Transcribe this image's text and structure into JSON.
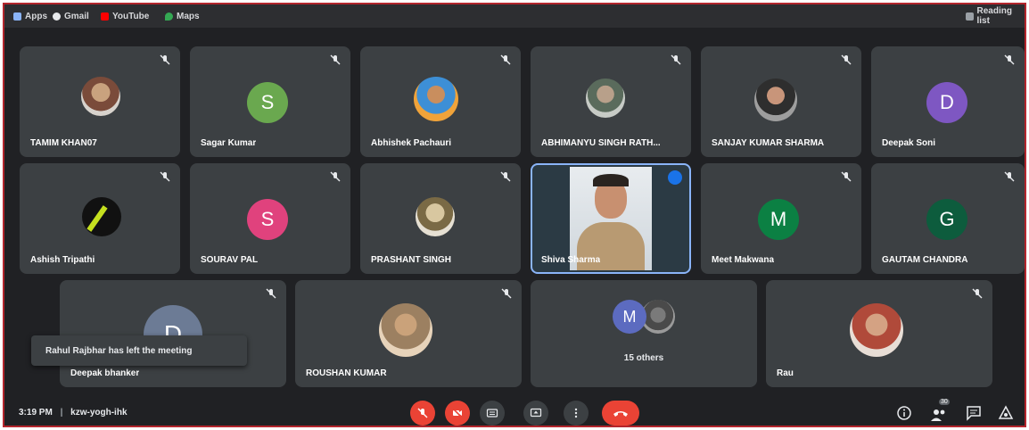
{
  "bookmarks": [
    {
      "label": "Apps",
      "icon": "apps-grid-icon",
      "color": "#8ab4f8"
    },
    {
      "label": "Gmail",
      "icon": "gmail-icon",
      "color": "#ea4335"
    },
    {
      "label": "YouTube",
      "icon": "youtube-icon",
      "color": "#ff0000"
    },
    {
      "label": "Maps",
      "icon": "maps-pin-icon",
      "color": "#34a853"
    }
  ],
  "reading_list": "Reading list",
  "participants": [
    {
      "name": "TAMIM KHAN07"
    },
    {
      "name": "Sagar Kumar",
      "initial": "S",
      "color": "#6aa84f"
    },
    {
      "name": "Abhishek Pachauri"
    },
    {
      "name": "ABHIMANYU SINGH RATH..."
    },
    {
      "name": "SANJAY KUMAR SHARMA"
    },
    {
      "name": "Deepak Soni",
      "initial": "D",
      "color": "#7e57c2"
    },
    {
      "name": "Ashish Tripathi"
    },
    {
      "name": "SOURAV PAL",
      "initial": "S",
      "color": "#e0427d"
    },
    {
      "name": "PRASHANT SINGH"
    },
    {
      "name": "Shiva Sharma"
    },
    {
      "name": "Meet Makwana",
      "initial": "M",
      "color": "#0b8043"
    },
    {
      "name": "GAUTAM CHANDRA",
      "initial": "G",
      "color": "#0d5c3d"
    },
    {
      "name": "Deepak bhanker",
      "initial": "D",
      "color": "#6c7b95"
    },
    {
      "name": "ROUSHAN KUMAR"
    },
    {
      "name": "15 others",
      "initial": "M",
      "color": "#5c6bc0"
    },
    {
      "name": "Rau"
    }
  ],
  "toast": "Rahul Rajbhar has left the meeting",
  "bottom_bar": {
    "time": "3:19 PM",
    "separator": "|",
    "meeting_code": "kzw-yogh-ihk",
    "participants_badge": "30"
  },
  "colors": {
    "accent_blue": "#8ab4f8",
    "red": "#ea4335",
    "tile": "#3c4043",
    "background": "#202124"
  }
}
